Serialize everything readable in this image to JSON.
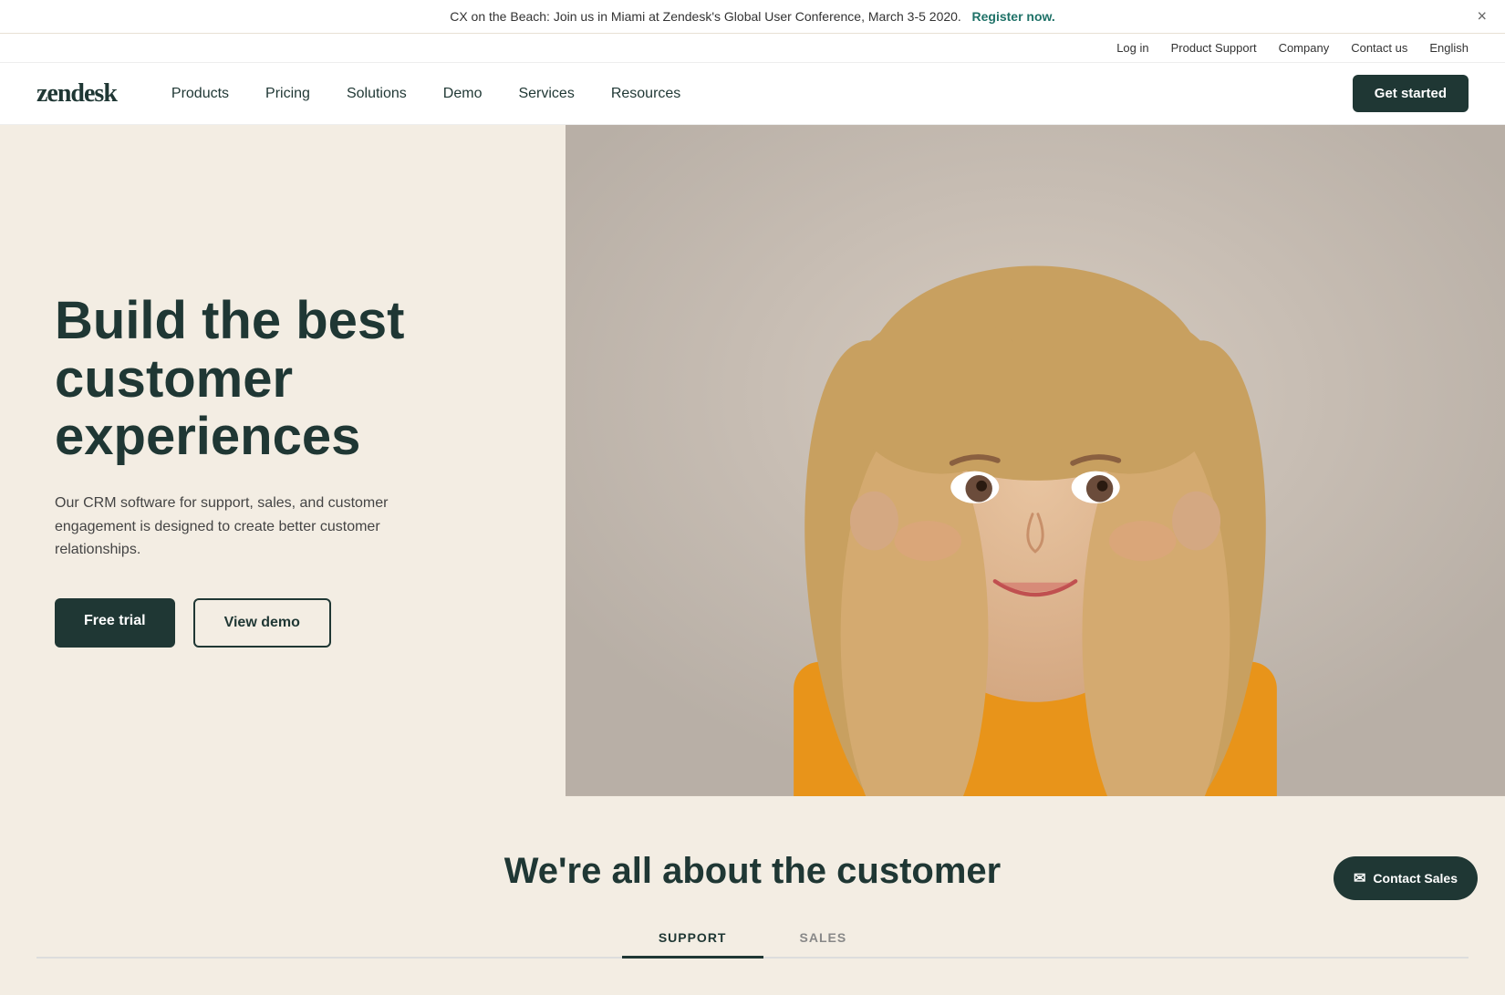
{
  "banner": {
    "text": "CX on the Beach: Join us in Miami at Zendesk's Global User Conference, March 3-5 2020.",
    "link_text": "Register now.",
    "close_label": "×"
  },
  "top_nav": {
    "items": [
      {
        "label": "Log in",
        "id": "login"
      },
      {
        "label": "Product Support",
        "id": "product-support"
      },
      {
        "label": "Company",
        "id": "company"
      },
      {
        "label": "Contact us",
        "id": "contact-us"
      },
      {
        "label": "English",
        "id": "language"
      }
    ]
  },
  "main_nav": {
    "logo": "zendesk",
    "links": [
      {
        "label": "Products",
        "id": "products"
      },
      {
        "label": "Pricing",
        "id": "pricing"
      },
      {
        "label": "Solutions",
        "id": "solutions"
      },
      {
        "label": "Demo",
        "id": "demo"
      },
      {
        "label": "Services",
        "id": "services"
      },
      {
        "label": "Resources",
        "id": "resources"
      }
    ],
    "cta": "Get started"
  },
  "hero": {
    "title": "Build the best customer experiences",
    "subtitle": "Our CRM software for support, sales, and customer engagement is designed to create better customer relationships.",
    "btn_primary": "Free trial",
    "btn_secondary": "View demo"
  },
  "below_hero": {
    "heading": "We're all about the customer",
    "tabs": [
      {
        "label": "SUPPORT",
        "active": true
      },
      {
        "label": "SALES",
        "active": false
      }
    ]
  },
  "contact_sales": {
    "label": "Contact Sales",
    "icon": "✉"
  }
}
